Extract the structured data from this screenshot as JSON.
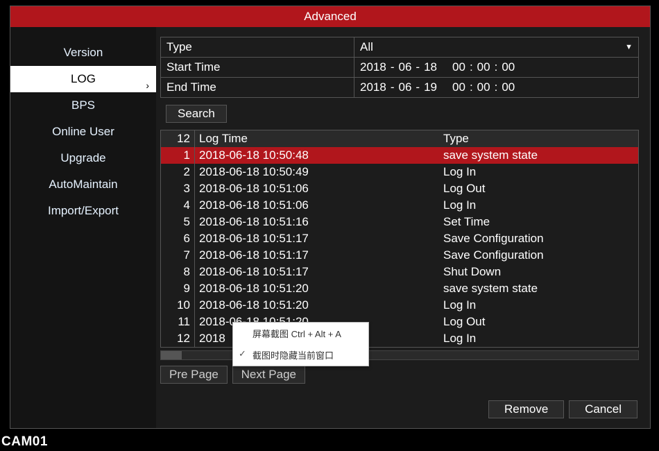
{
  "title": "Advanced",
  "cam_label": "CAM01",
  "sidebar": {
    "items": [
      {
        "label": "Version"
      },
      {
        "label": "LOG",
        "selected": true
      },
      {
        "label": "BPS"
      },
      {
        "label": "Online User"
      },
      {
        "label": "Upgrade"
      },
      {
        "label": "AutoMaintain"
      },
      {
        "label": "Import/Export"
      }
    ]
  },
  "filters": {
    "type_label": "Type",
    "type_value": "All",
    "start_label": "Start Time",
    "start_date": {
      "y": "2018",
      "m": "06",
      "d": "18"
    },
    "start_time": {
      "h": "00",
      "mi": "00",
      "s": "00"
    },
    "end_label": "End Time",
    "end_date": {
      "y": "2018",
      "m": "06",
      "d": "19"
    },
    "end_time": {
      "h": "00",
      "mi": "00",
      "s": "00"
    }
  },
  "buttons": {
    "search": "Search",
    "pre_page": "Pre Page",
    "next_page": "Next Page",
    "remove": "Remove",
    "cancel": "Cancel"
  },
  "log": {
    "count_header": "12",
    "headers": {
      "time": "Log Time",
      "type": "Type"
    },
    "rows": [
      {
        "idx": "1",
        "time": "2018-06-18 10:50:48",
        "type": "save system state",
        "selected": true
      },
      {
        "idx": "2",
        "time": "2018-06-18 10:50:49",
        "type": "Log In"
      },
      {
        "idx": "3",
        "time": "2018-06-18 10:51:06",
        "type": "Log Out"
      },
      {
        "idx": "4",
        "time": "2018-06-18 10:51:06",
        "type": "Log In"
      },
      {
        "idx": "5",
        "time": "2018-06-18 10:51:16",
        "type": "Set Time"
      },
      {
        "idx": "6",
        "time": "2018-06-18 10:51:17",
        "type": "Save Configuration"
      },
      {
        "idx": "7",
        "time": "2018-06-18 10:51:17",
        "type": "Save Configuration"
      },
      {
        "idx": "8",
        "time": "2018-06-18 10:51:17",
        "type": "Shut Down"
      },
      {
        "idx": "9",
        "time": "2018-06-18 10:51:20",
        "type": "save system state"
      },
      {
        "idx": "10",
        "time": "2018-06-18 10:51:20",
        "type": "Log In"
      },
      {
        "idx": "11",
        "time": "2018-06-18 10:51:20",
        "type": "Log Out"
      },
      {
        "idx": "12",
        "time": "2018",
        "type": "Log In"
      }
    ]
  },
  "popup": {
    "line1": "屏幕截图 Ctrl + Alt + A",
    "line2": "截图时隐藏当前窗口"
  }
}
